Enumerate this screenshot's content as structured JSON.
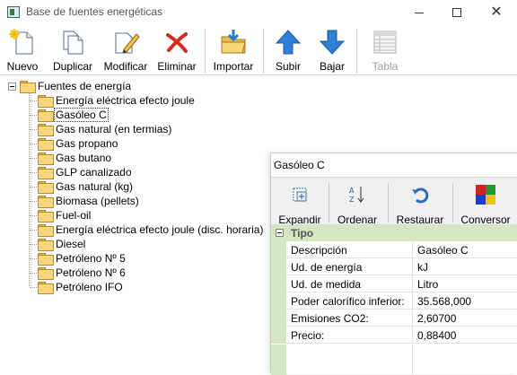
{
  "window": {
    "title": "Base de fuentes energéticas"
  },
  "toolbar": [
    {
      "label": "Nuevo",
      "icon": "new-icon"
    },
    {
      "label": "Duplicar",
      "icon": "duplicate-icon"
    },
    {
      "label": "Modificar",
      "icon": "edit-pencil-icon"
    },
    {
      "label": "Eliminar",
      "icon": "delete-x-icon"
    },
    {
      "label": "Importar",
      "icon": "import-folder-icon"
    },
    {
      "label": "Subir",
      "icon": "arrow-up-icon"
    },
    {
      "label": "Bajar",
      "icon": "arrow-down-icon"
    },
    {
      "label": "Tabla",
      "icon": "table-icon",
      "disabled": true
    }
  ],
  "tree": {
    "root": "Fuentes de energía",
    "items": [
      "Energía eléctrica efecto joule",
      "Gasóleo C",
      "Gas natural (en termias)",
      "Gas propano",
      "Gas butano",
      "GLP canalizado",
      "Gas natural (kg)",
      "Biomasa (pellets)",
      "Fuel-oil",
      "Energía eléctrica efecto joule (disc. horaria)",
      "Diesel",
      "Petróleno Nº 5",
      "Petróleno Nº 6",
      "Petróleno IFO"
    ],
    "selected": "Gasóleo C"
  },
  "panel": {
    "title": "Gasóleo C",
    "toolbar": [
      {
        "label": "Expandir",
        "icon": "expand-icon"
      },
      {
        "label": "Ordenar",
        "icon": "sort-az-icon"
      },
      {
        "label": "Restaurar",
        "icon": "restore-icon"
      },
      {
        "label": "Conversor",
        "icon": "converter-icon"
      }
    ],
    "category": "Tipo",
    "properties": [
      {
        "name": "Descripción",
        "value": "Gasóleo C"
      },
      {
        "name": "Ud. de energía",
        "value": "kJ"
      },
      {
        "name": "Ud. de medida",
        "value": "Litro"
      },
      {
        "name": "Poder calorífico inferior:",
        "value": "35.568,000"
      },
      {
        "name": "Emisiones CO2:",
        "value": "2,60700"
      },
      {
        "name": "Precio:",
        "value": "0,88400"
      }
    ]
  }
}
